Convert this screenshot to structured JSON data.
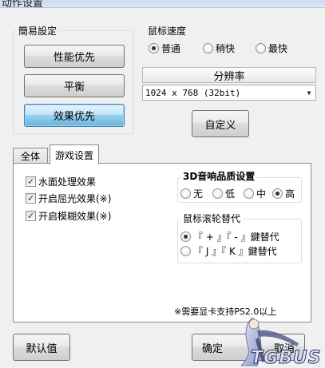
{
  "window": {
    "title": "动作设置"
  },
  "simple_settings": {
    "title": "簡易設定",
    "buttons": [
      "性能优先",
      "平衡",
      "效果优先"
    ],
    "active": "效果优先"
  },
  "mouse_speed": {
    "title": "鼠标速度",
    "options": [
      {
        "label": "普通",
        "selected": true
      },
      {
        "label": "稍快",
        "selected": false
      },
      {
        "label": "最快",
        "selected": false
      }
    ]
  },
  "resolution": {
    "title": "分辨率",
    "selected": "1024 x 768 (32bit)"
  },
  "custom_button": "自定义",
  "tabs": [
    {
      "label": "全体",
      "active": false
    },
    {
      "label": "游戏设置",
      "active": true
    }
  ],
  "effects": [
    {
      "label": "水面处理效果",
      "checked": true
    },
    {
      "label": "开启屈光效果(※)",
      "checked": true
    },
    {
      "label": "开启模糊效果(※)",
      "checked": true
    }
  ],
  "audio_quality": {
    "title": "3D音响品质设置",
    "options": [
      {
        "label": "无",
        "selected": false
      },
      {
        "label": "低",
        "selected": false
      },
      {
        "label": "中",
        "selected": false
      },
      {
        "label": "高",
        "selected": true
      }
    ]
  },
  "scroll_wheel": {
    "title": "鼠标滚轮替代",
    "options": [
      {
        "label": "『 + 』『 - 』鍵替代",
        "selected": true
      },
      {
        "label": "『 J 』『 K 』鍵替代",
        "selected": false
      }
    ]
  },
  "note": "※需要显卡支持PS2.0以上",
  "footer": {
    "default_button": "默认值",
    "ok_button": "确定",
    "cancel_button": "取消"
  },
  "watermark_text": "TGBUS"
}
